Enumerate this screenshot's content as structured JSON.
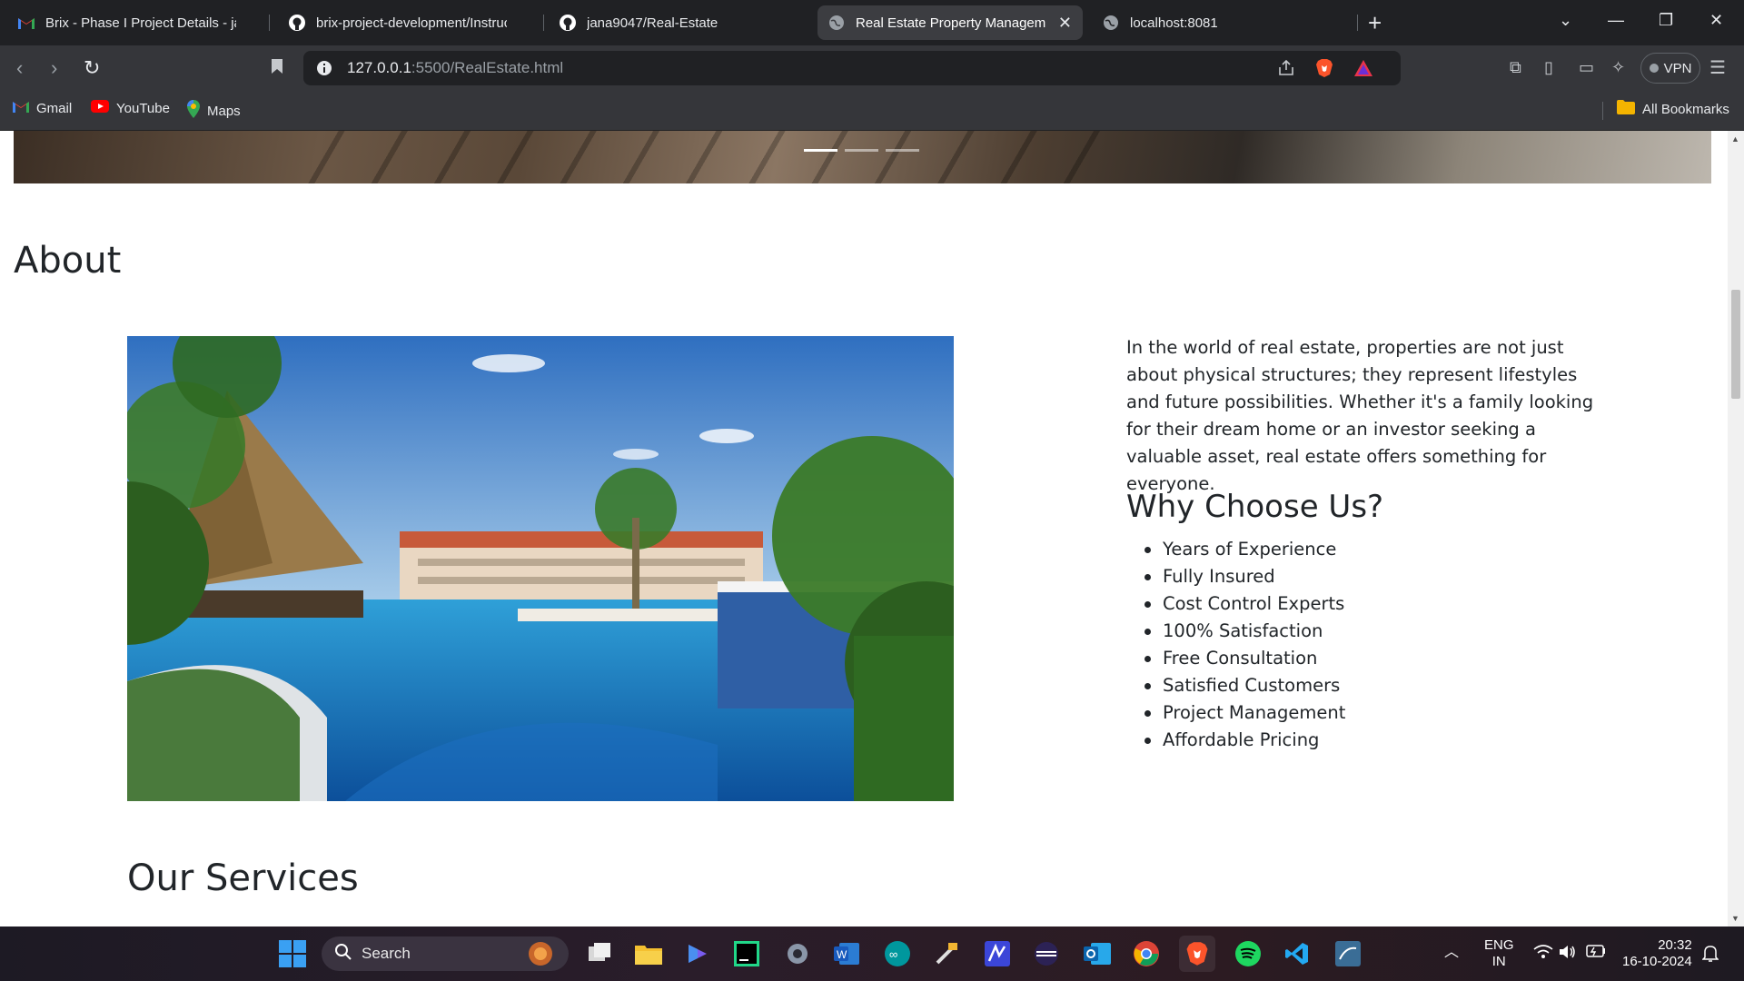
{
  "browser": {
    "tabs": [
      {
        "label": "Brix - Phase I Project Details - janaja",
        "icon": "gmail-icon"
      },
      {
        "label": "brix-project-development/Instructio",
        "icon": "github-icon"
      },
      {
        "label": "jana9047/Real-Estate",
        "icon": "github-icon"
      },
      {
        "label": "Real Estate Property Manageme",
        "icon": "globe-icon",
        "active": true
      },
      {
        "label": "localhost:8081",
        "icon": "globe-icon"
      }
    ],
    "address": {
      "host": "127.0.0.1",
      "rest": ":5500/RealEstate.html"
    },
    "vpn_label": "VPN",
    "bookmarks": [
      {
        "label": "Gmail",
        "icon": "gmail-icon"
      },
      {
        "label": "YouTube",
        "icon": "youtube-icon"
      },
      {
        "label": "Maps",
        "icon": "maps-icon"
      }
    ],
    "all_bookmarks_label": "All Bookmarks"
  },
  "page": {
    "about_title": "About",
    "about_text": "In the world of real estate, properties are not just about physical structures; they represent lifestyles and future possibilities. Whether it's a family looking for their dream home or an investor seeking a valuable asset, real estate offers something for everyone.",
    "why_title": "Why Choose Us?",
    "why_items": [
      "Years of Experience",
      "Fully Insured",
      "Cost Control Experts",
      "100% Satisfaction",
      "Free Consultation",
      "Satisfied Customers",
      "Project Management",
      "Affordable Pricing"
    ],
    "services_title": "Our Services",
    "carousel_active_index": 1,
    "carousel_count": 3
  },
  "taskbar": {
    "search_placeholder": "Search",
    "lang_line1": "ENG",
    "lang_line2": "IN",
    "time": "20:32",
    "date": "16-10-2024"
  },
  "colors": {
    "browser_dark": "#202124",
    "toolbar": "#35363a",
    "text_dark": "#212529"
  }
}
